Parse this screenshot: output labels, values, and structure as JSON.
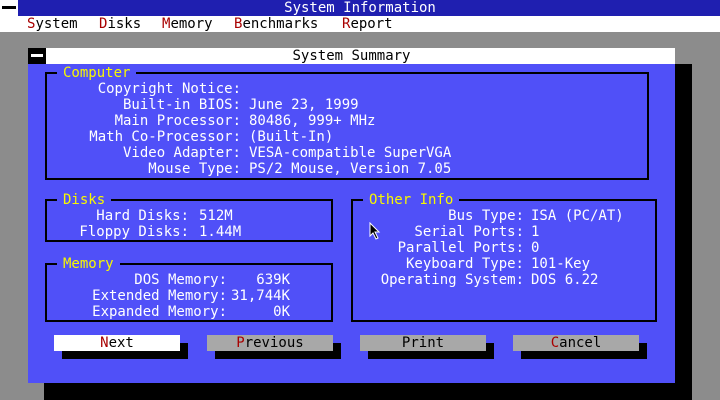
{
  "app": {
    "title": "System Information"
  },
  "menu": [
    {
      "hot": "S",
      "rest": "ystem"
    },
    {
      "hot": "D",
      "rest": "isks"
    },
    {
      "hot": "M",
      "rest": "emory"
    },
    {
      "hot": "B",
      "rest": "enchmarks"
    },
    {
      "hot": "R",
      "rest": "eport"
    }
  ],
  "dialog": {
    "title": "System Summary",
    "computer": {
      "title": "Computer",
      "rows": [
        {
          "label": "Copyright Notice:",
          "value": ""
        },
        {
          "label": "Built-in BIOS:",
          "value": "June 23, 1999"
        },
        {
          "label": "Main Processor:",
          "value": "80486, 999+ MHz"
        },
        {
          "label": "Math Co-Processor:",
          "value": "(Built-In)"
        },
        {
          "label": "Video Adapter:",
          "value": "VESA-compatible SuperVGA"
        },
        {
          "label": "Mouse Type:",
          "value": "PS/2 Mouse, Version 7.05"
        }
      ]
    },
    "disks": {
      "title": "Disks",
      "rows": [
        {
          "label": "Hard Disks:",
          "value": "512M"
        },
        {
          "label": "Floppy Disks:",
          "value": "1.44M"
        }
      ]
    },
    "memory": {
      "title": "Memory",
      "rows": [
        {
          "label": "DOS Memory:",
          "value": "639K"
        },
        {
          "label": "Extended Memory:",
          "value": "31,744K"
        },
        {
          "label": "Expanded Memory:",
          "value": "0K"
        }
      ]
    },
    "other": {
      "title": "Other Info",
      "rows": [
        {
          "label": "Bus Type:",
          "value": "ISA (PC/AT)"
        },
        {
          "label": "Serial Ports:",
          "value": "1"
        },
        {
          "label": "Parallel Ports:",
          "value": "0"
        },
        {
          "label": "Keyboard Type:",
          "value": "101-Key"
        },
        {
          "label": "Operating System:",
          "value": "DOS 6.22"
        }
      ]
    },
    "buttons": {
      "next": {
        "hot": "N",
        "rest": "ext"
      },
      "previous": {
        "hot": "P",
        "rest": "revious"
      },
      "print": {
        "hot": "",
        "rest": "Print"
      },
      "cancel": {
        "hot": "C",
        "rest": "ancel"
      }
    }
  },
  "colors": {
    "desktop": "#8c8c8c",
    "title_bar": "#1f1fb0",
    "dialog": "#5050f8",
    "group_title": "#f8f800",
    "hotkey": "#a80000",
    "button_focus": "#ffffff",
    "button": "#a8a8a8"
  },
  "icons": [
    "window-menu-icon",
    "dialog-close-icon",
    "mouse-pointer-icon"
  ]
}
